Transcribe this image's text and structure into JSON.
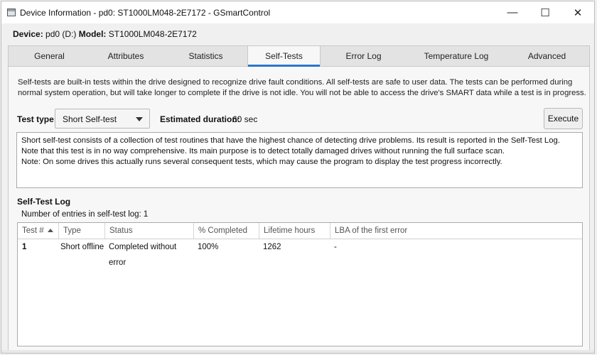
{
  "window": {
    "title": "Device Information - pd0: ST1000LM048-2E7172 - GSmartControl",
    "icon": "drive-icon",
    "controls": {
      "minimize": "—",
      "maximize": "☐",
      "close": "✕"
    }
  },
  "device": {
    "device_label": "Device:",
    "device_value": "pd0 (D:)",
    "model_label": "Model:",
    "model_value": "ST1000LM048-2E7172"
  },
  "tabs": [
    {
      "label": "General"
    },
    {
      "label": "Attributes"
    },
    {
      "label": "Statistics"
    },
    {
      "label": "Self-Tests",
      "active": true
    },
    {
      "label": "Error Log"
    },
    {
      "label": "Temperature Log"
    },
    {
      "label": "Advanced"
    }
  ],
  "selftests": {
    "intro": "Self-tests are built-in tests within the drive designed to recognize drive fault conditions. All self-tests are safe to user data. The tests can be performed during normal system operation, but will take longer to complete if the drive is not idle. You will not be able to access the drive's SMART data while a test is in progress.",
    "test_type_label": "Test type:",
    "test_type_value": "Short Self-test",
    "estimated_label": "Estimated duration:",
    "estimated_value": "60 sec",
    "execute_label": "Execute",
    "description_line1": "Short self-test consists of a collection of test routines that have the highest chance of detecting drive problems. Its result is reported in the Self-Test Log. Note that this test is in no way comprehensive. Its main purpose is to detect totally damaged drives without running the full surface scan.",
    "description_line2": "Note: On some drives this actually runs several consequent tests, which may cause the program to display the test progress incorrectly."
  },
  "log": {
    "heading": "Self-Test Log",
    "entries_text": "Number of entries in self-test log: 1",
    "columns": [
      "Test #",
      "Type",
      "Status",
      "% Completed",
      "Lifetime hours",
      "LBA of the first error"
    ],
    "rows": [
      [
        "1",
        "Short offline",
        "Completed without error",
        "100%",
        "1262",
        "-"
      ]
    ]
  },
  "colors": {
    "accent": "#2a77c9",
    "background": "#f0f0f0"
  }
}
